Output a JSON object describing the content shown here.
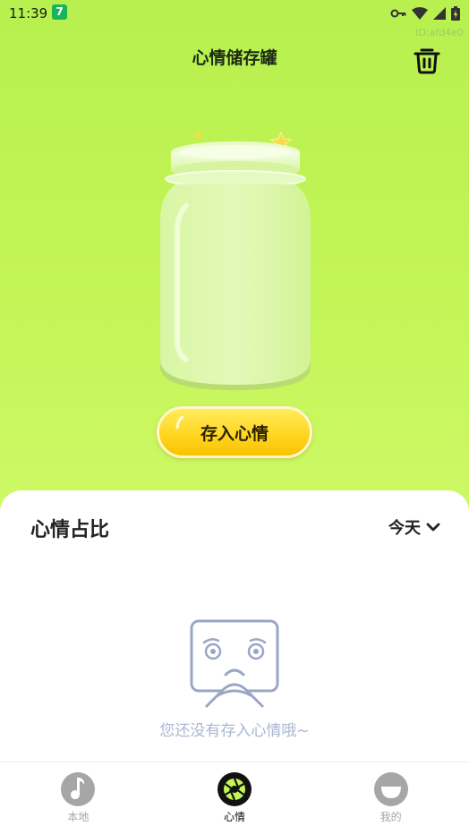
{
  "status_bar": {
    "time": "11:39",
    "app_badge": "7",
    "icons": [
      "key-icon",
      "wifi-icon",
      "signal-icon",
      "battery-icon"
    ]
  },
  "id_label": "ID:afd4e0",
  "header": {
    "title": "心情储存罐",
    "trash_icon": "trash-icon"
  },
  "jar": {
    "icon": "mood-jar-illustration"
  },
  "save_button": {
    "label": "存入心情"
  },
  "mood_ratio": {
    "title": "心情占比",
    "range": {
      "selected": "今天",
      "icon": "chevron-down-icon"
    },
    "empty_state": {
      "icon": "sad-face-illustration",
      "text": "您还没有存入心情哦~"
    }
  },
  "tabs": [
    {
      "label": "本地",
      "icon": "music-note-icon",
      "active": false
    },
    {
      "label": "心情",
      "icon": "aperture-icon",
      "active": true
    },
    {
      "label": "我的",
      "icon": "smile-face-icon",
      "active": false
    }
  ],
  "colors": {
    "background": "#c3f556",
    "accent_yellow": "#ffd41e",
    "empty_text": "#aab6d3",
    "tab_inactive": "#a6a6a6"
  }
}
